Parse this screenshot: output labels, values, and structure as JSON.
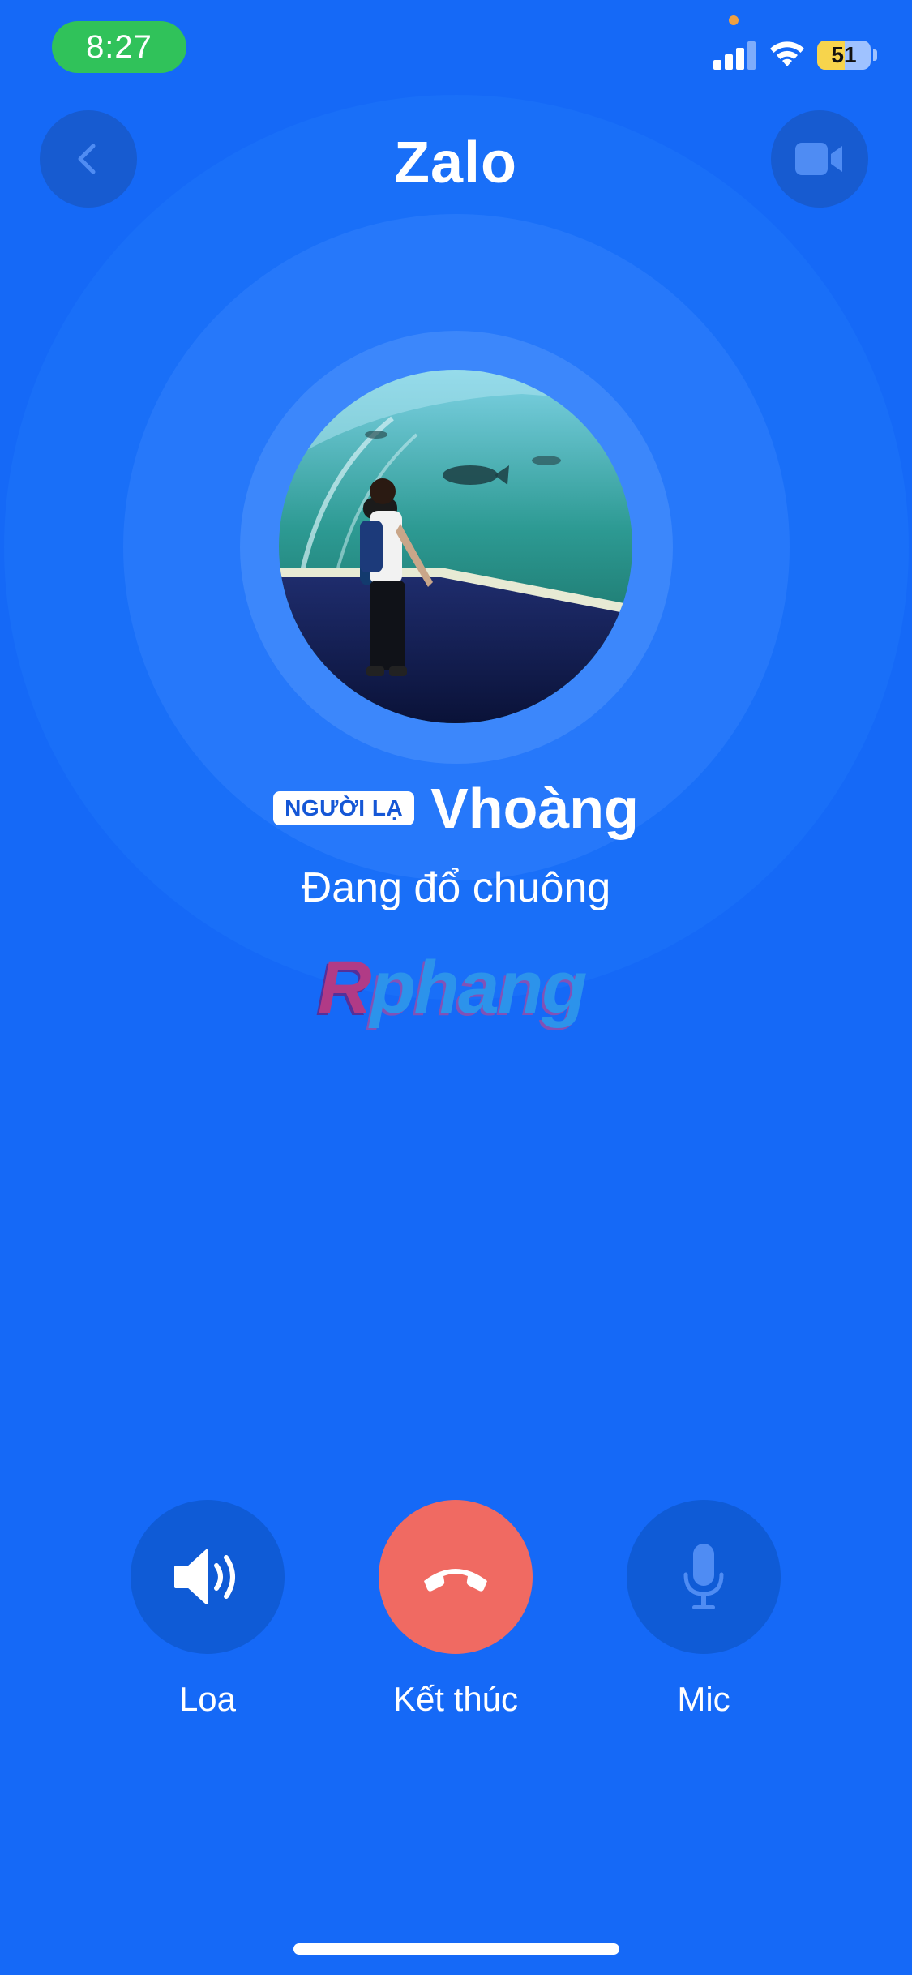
{
  "status_bar": {
    "time": "8:27",
    "battery_level": "51",
    "battery_fraction": 0.51,
    "icons": [
      "cellular-signal-icon",
      "wifi-icon",
      "battery-icon"
    ]
  },
  "header": {
    "app_title": "Zalo",
    "back_icon": "chevron-left-icon",
    "video_icon": "video-camera-icon"
  },
  "caller": {
    "badge": "NGƯỜI LẠ",
    "name": "Vhoàng",
    "status": "Đang đổ chuông"
  },
  "watermark": {
    "first_letter": "R",
    "rest": "phang"
  },
  "controls": {
    "speaker": {
      "label": "Loa",
      "icon": "speaker-icon"
    },
    "end_call": {
      "label": "Kết thúc",
      "icon": "hang-up-icon"
    },
    "mic": {
      "label": "Mic",
      "icon": "microphone-icon"
    }
  },
  "colors": {
    "background": "#1569f7",
    "end_call": "#f06a62",
    "control_bg": "#0f5bd6",
    "status_time_pill": "#30c25a"
  }
}
